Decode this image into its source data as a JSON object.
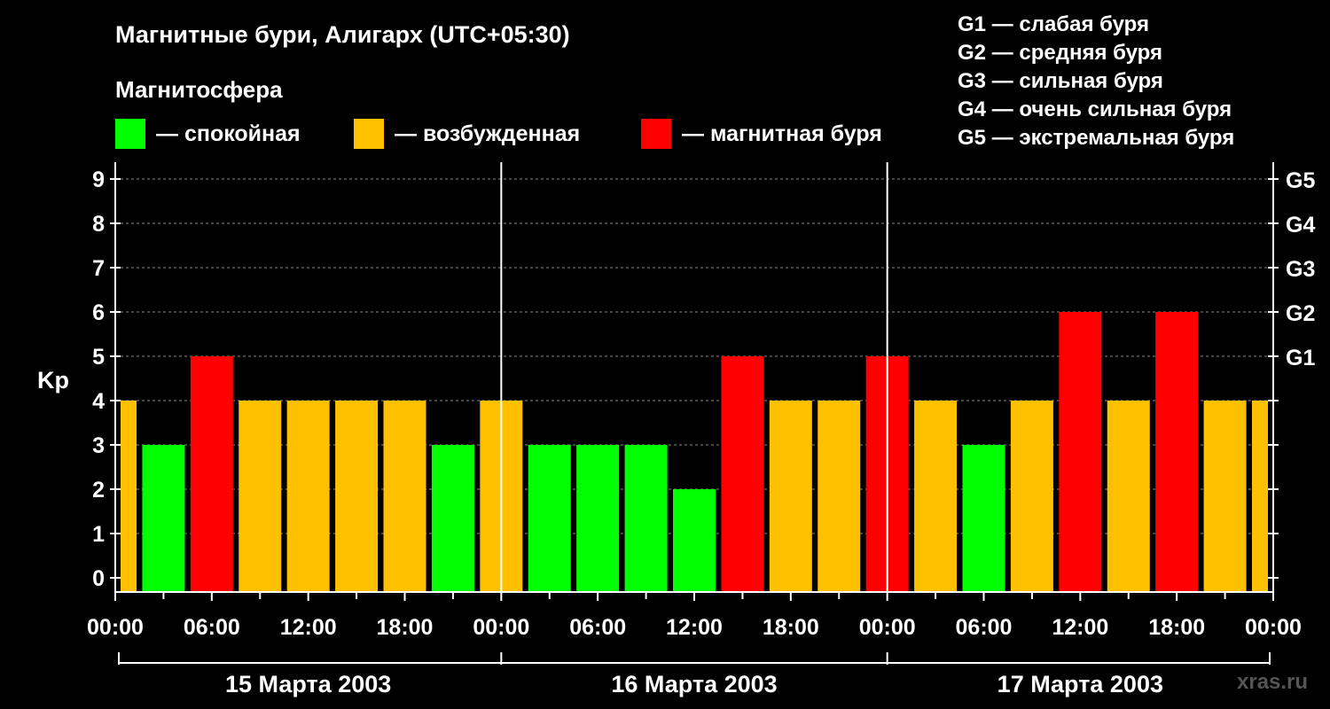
{
  "header": {
    "title": "Магнитные бури, Алигарх (UTC+05:30)",
    "subtitle": "Магнитосфера"
  },
  "legend": [
    {
      "label": "— спокойная",
      "color": "#00ff00"
    },
    {
      "label": "— возбужденная",
      "color": "#ffc000"
    },
    {
      "label": "— магнитная буря",
      "color": "#ff0000"
    }
  ],
  "g_scale": [
    "G1 — слабая буря",
    "G2 — средняя буря",
    "G3 — сильная буря",
    "G4 — очень сильная буря",
    "G5 — экстремальная буря"
  ],
  "watermark": "xras.ru",
  "chart_data": {
    "type": "bar",
    "title": "Магнитные бури, Алигарх (UTC+05:30)",
    "ylabel": "Kp",
    "ylim": [
      0,
      9
    ],
    "y_ticks": [
      "0",
      "1",
      "2",
      "3",
      "4",
      "5",
      "6",
      "7",
      "8",
      "9"
    ],
    "right_axis_labels": [
      {
        "value": 5,
        "label": "G1"
      },
      {
        "value": 6,
        "label": "G2"
      },
      {
        "value": 7,
        "label": "G3"
      },
      {
        "value": 8,
        "label": "G4"
      },
      {
        "value": 9,
        "label": "G5"
      }
    ],
    "x_tick_labels": [
      "00:00",
      "06:00",
      "12:00",
      "18:00",
      "00:00",
      "06:00",
      "12:00",
      "18:00",
      "00:00",
      "06:00",
      "12:00",
      "18:00",
      "00:00"
    ],
    "days": [
      "15 Марта 2003",
      "16 Марта 2003",
      "17 Марта 2003"
    ],
    "colors": {
      "quiet": "#00ff00",
      "active": "#ffc000",
      "storm": "#ff0000"
    },
    "grid": true,
    "values": [
      4,
      3,
      5,
      4,
      4,
      4,
      4,
      3,
      4,
      3,
      3,
      3,
      2,
      5,
      4,
      4,
      5,
      4,
      3,
      4,
      6,
      4,
      6,
      4,
      4
    ]
  }
}
